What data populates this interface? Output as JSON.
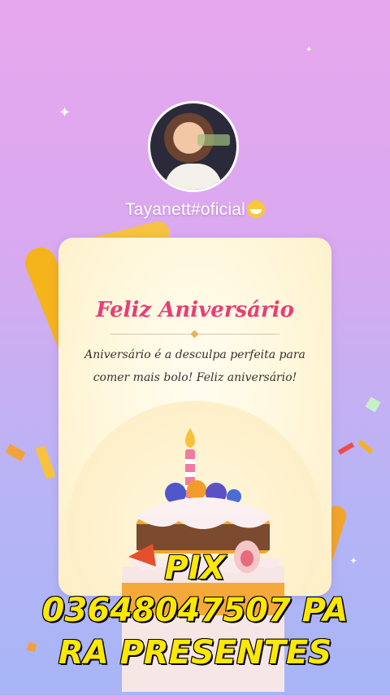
{
  "profile": {
    "username": "Tayanett#oficial",
    "emoji_icon": "grinning-face-icon"
  },
  "card": {
    "title": "Feliz Aniversário",
    "message_line1": "Aniversário é a desculpa perfeita para",
    "message_line2": "comer mais bolo! Feliz aniversário!"
  },
  "overlay": {
    "line1": "PIX",
    "line2": "03648047507 PA",
    "line3": "RA PRESENTES"
  },
  "colors": {
    "title": "#ea3d76",
    "overlay_text": "#ffe800",
    "ribbon": "#f5b31c"
  }
}
